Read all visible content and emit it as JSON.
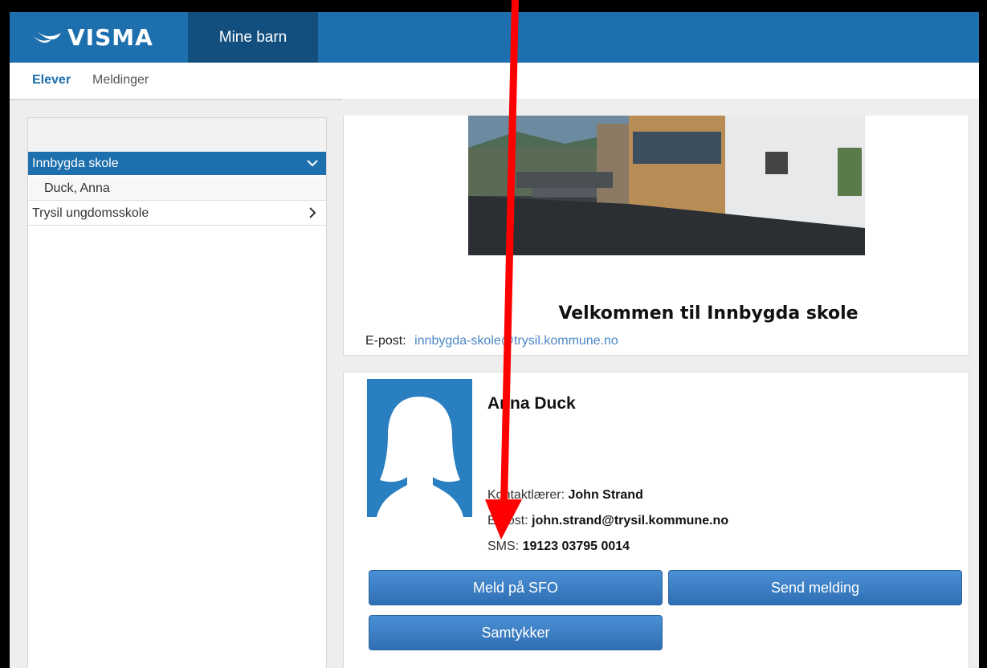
{
  "header": {
    "logo_text": "VISMA",
    "active_tab": "Mine barn"
  },
  "subnav": {
    "items": [
      "Elever",
      "Meldinger"
    ]
  },
  "sidebar": {
    "items": [
      {
        "label": "Innbygda skole",
        "state": "expanded",
        "icon": "chevron-down-icon"
      },
      {
        "label": "Duck, Anna",
        "state": "child"
      },
      {
        "label": "Trysil ungdomsskole",
        "state": "collapsed",
        "icon": "chevron-right-icon"
      }
    ]
  },
  "school_card": {
    "welcome": "Velkommen til Innbygda skole",
    "email_label": "E-post:",
    "email": "innbygda-skole@trysil.kommune.no"
  },
  "student_card": {
    "name": "Anna Duck",
    "contact_teacher_label": "Kontaktlærer:",
    "contact_teacher": "John Strand",
    "email_label": "E-post:",
    "email": "john.strand@trysil.kommune.no",
    "sms_label": "SMS:",
    "sms": "19123 03795 0014",
    "buttons": {
      "sfo": "Meld på SFO",
      "message": "Send melding",
      "consent": "Samtykker"
    }
  },
  "colors": {
    "brand_blue": "#1d6fad",
    "dark_tab": "#124f7e",
    "annotation_arrow": "#ff0000"
  }
}
